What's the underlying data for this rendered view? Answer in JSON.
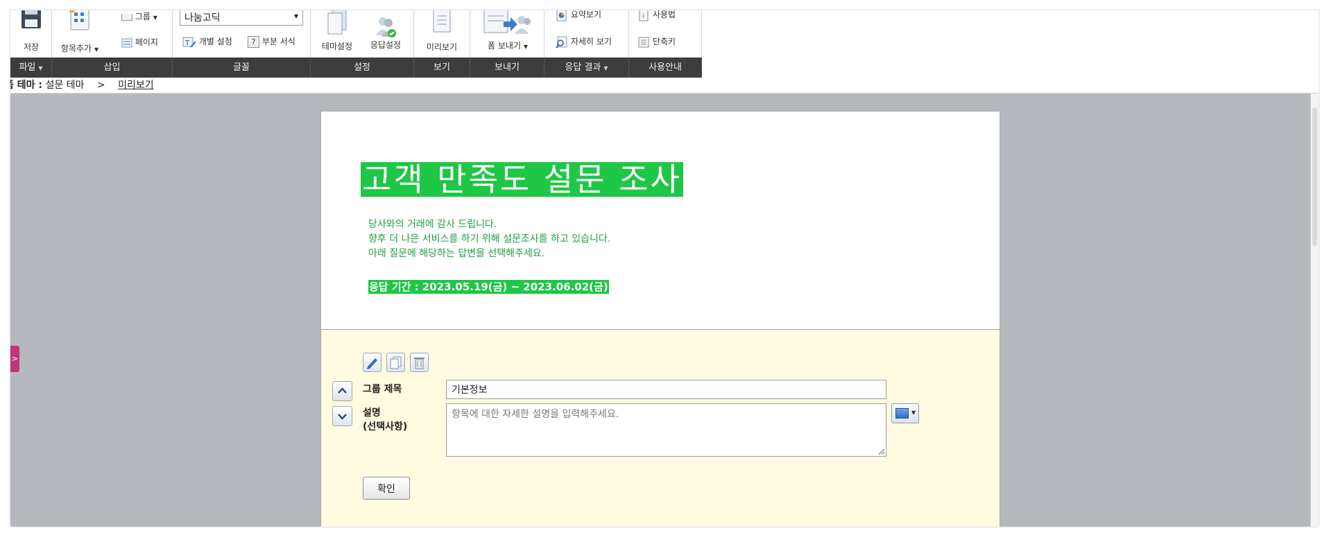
{
  "ribbon": {
    "file": {
      "save_label": "저장"
    },
    "insert": {
      "add_item_label": "항목추가",
      "group_label": "그룹",
      "page_label": "페이지"
    },
    "font": {
      "font_name": "나눔고딕",
      "individual_label": "개별 설정",
      "partial_label": "부분 서식"
    },
    "settings": {
      "theme_label": "테마설정",
      "response_label": "응답설정"
    },
    "view": {
      "preview_label": "미리보기"
    },
    "export": {
      "send_form_label": "폼 보내기"
    },
    "results": {
      "summary_label": "요약보기",
      "detail_label": "자세히 보기"
    },
    "guide": {
      "usage_label": "사용법",
      "shortcut_label": "단축키"
    }
  },
  "tabs": [
    {
      "label": "파일",
      "dropdown": true
    },
    {
      "label": "삽입",
      "dropdown": false
    },
    {
      "label": "글꼴",
      "dropdown": false
    },
    {
      "label": "설정",
      "dropdown": false
    },
    {
      "label": "보기",
      "dropdown": false
    },
    {
      "label": "보내기",
      "dropdown": false
    },
    {
      "label": "응답 결과",
      "dropdown": true
    },
    {
      "label": "사용안내",
      "dropdown": false
    }
  ],
  "breadcrumb": {
    "key": "폼 테마 :",
    "theme": "설문 테마",
    "separator": ">",
    "current": "미리보기"
  },
  "survey": {
    "title": "고객 만족도 설문 조사",
    "intro": [
      "당사와의 거래에 감사 드립니다.",
      "향후 더 나은 서비스를 하기 위해 설문조사를 하고 있습니다.",
      "아래 질문에 해당하는 답변을 선택해주세요."
    ],
    "period": "응답 기간 : 2023.05.19(금) ~ 2023.06.02(금)"
  },
  "editor": {
    "group_title_label": "그룹 제목",
    "group_title_value": "기본정보",
    "desc_label_1": "설명",
    "desc_label_2": "(선택사항)",
    "desc_placeholder": "항목에 대한 자세한 설명을 입력해주세요.",
    "confirm_label": "확인"
  },
  "colors": {
    "title_bg": "#1ec746",
    "intro_text": "#1f9e3f",
    "tabbar_bg": "#3d3d3d",
    "canvas_bg": "#b5b8bc",
    "editor_bg": "#fffbe0",
    "side_toggle": "#c2357a"
  }
}
